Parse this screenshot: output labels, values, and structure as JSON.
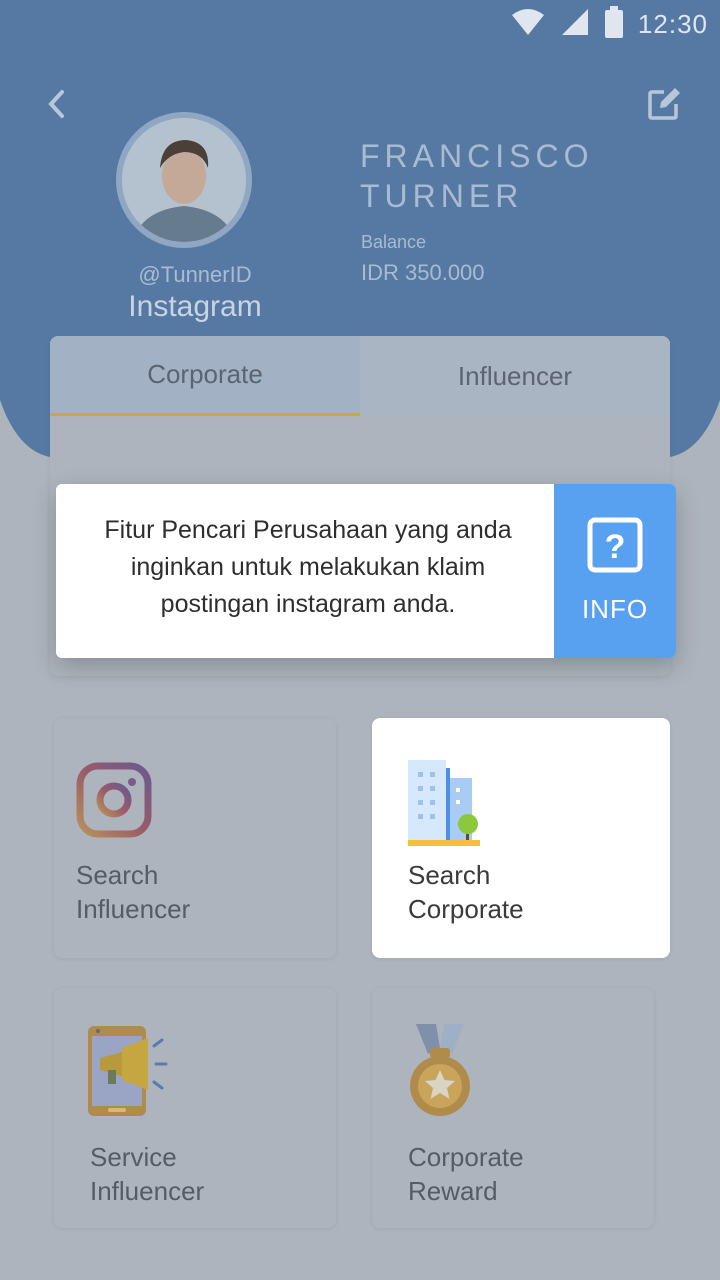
{
  "status_bar": {
    "time": "12:30",
    "icons": [
      "wifi-icon",
      "signal-icon",
      "battery-icon"
    ]
  },
  "header": {
    "back_icon": "chevron-left-icon",
    "edit_icon": "edit-icon",
    "profile": {
      "handle": "@TunnerID",
      "platform": "Instagram",
      "name": "FRANCISCO TURNER",
      "balance_label": "Balance",
      "balance_value": "IDR 350.000"
    }
  },
  "tabs": [
    {
      "label": "Corporate",
      "active": true
    },
    {
      "label": "Influencer",
      "active": false
    }
  ],
  "tooltip": {
    "text": "Fitur Pencari Perusahaan yang anda inginkan untuk melakukan klaim postingan instagram anda.",
    "info_label": "INFO",
    "info_icon": "question-icon"
  },
  "menu": [
    {
      "label": "Search\nInfluencer",
      "icon": "instagram-icon"
    },
    {
      "label": "Search\nCorporate",
      "icon": "building-icon"
    },
    {
      "label": "Service\nInfluencer",
      "icon": "megaphone-icon"
    },
    {
      "label": "Corporate\nReward",
      "icon": "medal-icon"
    }
  ],
  "colors": {
    "header": "#5679a3",
    "tab_underline": "#c9a93c",
    "info_blue": "#58a0f0",
    "overlay": "#aeb4bd"
  }
}
